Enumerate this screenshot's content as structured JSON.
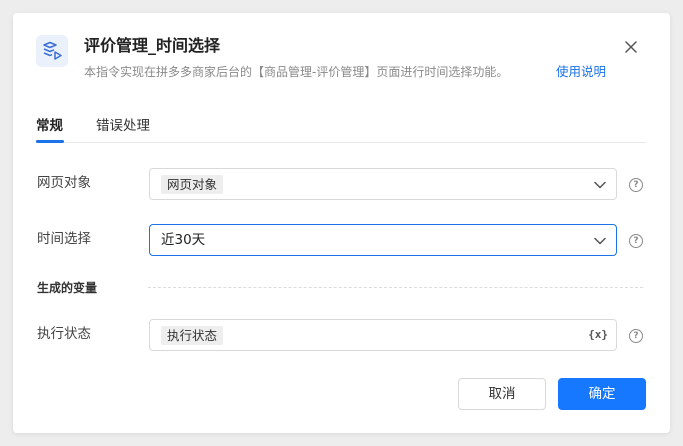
{
  "dialog": {
    "title": "评价管理_时间选择",
    "description": "本指令实现在拼多多商家后台的【商品管理-评价管理】页面进行时间选择功能。",
    "help_link": "使用说明",
    "header_icon": "command-icon",
    "close_icon": "close-icon"
  },
  "tabs": [
    {
      "label": "常规",
      "active": true
    },
    {
      "label": "错误处理",
      "active": false
    }
  ],
  "form": {
    "web_object": {
      "label": "网页对象",
      "value": "网页对象"
    },
    "time_select": {
      "label": "时间选择",
      "value": "近30天"
    },
    "section_title": "生成的变量",
    "exec_status": {
      "label": "执行状态",
      "value": "执行状态",
      "var_icon": "{x}"
    },
    "help_icon": "?"
  },
  "buttons": {
    "cancel": "取消",
    "confirm": "确定"
  },
  "colors": {
    "accent": "#1677ff",
    "link": "#1a73e8",
    "background": "#ededed"
  }
}
